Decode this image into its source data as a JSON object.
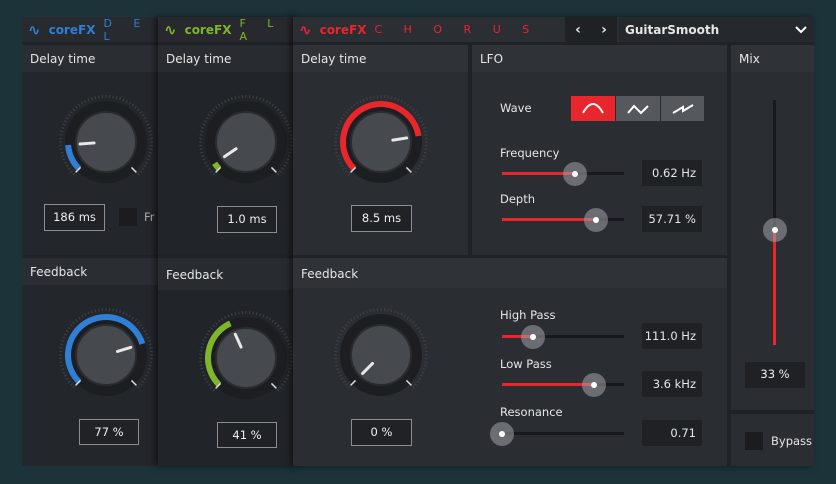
{
  "colors": {
    "delay": "#2f7fd4",
    "flanger": "#7fb52a",
    "chorus": "#e8262c"
  },
  "delay": {
    "brand": "coreFX",
    "name": "D E L",
    "delay_title": "Delay time",
    "delay_value": "186 ms",
    "delay_level": 0.15,
    "checkbox_label": "Fr",
    "feedback_title": "Feedback",
    "feedback_value": "77 %",
    "feedback_level": 0.77
  },
  "flanger": {
    "brand": "coreFX",
    "name": "F L A",
    "delay_title": "Delay time",
    "delay_value": "1.0 ms",
    "delay_level": 0.04,
    "feedback_title": "Feedback",
    "feedback_value": "41 %",
    "feedback_level": 0.41
  },
  "chorus": {
    "brand": "coreFX",
    "name": "C H O R U S",
    "preset": "GuitarSmooth",
    "delay_title": "Delay time",
    "delay_value": "8.5 ms",
    "delay_level": 0.8,
    "lfo": {
      "title": "LFO",
      "wave_label": "Wave",
      "waves": [
        "sine",
        "triangle",
        "saw"
      ],
      "selected_wave": "sine",
      "frequency": {
        "label": "Frequency",
        "value": "0.62 Hz",
        "level": 0.6
      },
      "depth": {
        "label": "Depth",
        "value": "57.71 %",
        "level": 0.77
      }
    },
    "feedback_title": "Feedback",
    "feedback_value": "0 %",
    "feedback_level": 0,
    "high_pass": {
      "label": "High Pass",
      "value": "111.0 Hz",
      "level": 0.25
    },
    "low_pass": {
      "label": "Low Pass",
      "value": "3.6 kHz",
      "level": 0.75
    },
    "resonance": {
      "label": "Resonance",
      "value": "0.71",
      "level": 0
    },
    "mix": {
      "title": "Mix",
      "value": "33 %",
      "level": 0.47
    },
    "bypass": "Bypass"
  }
}
